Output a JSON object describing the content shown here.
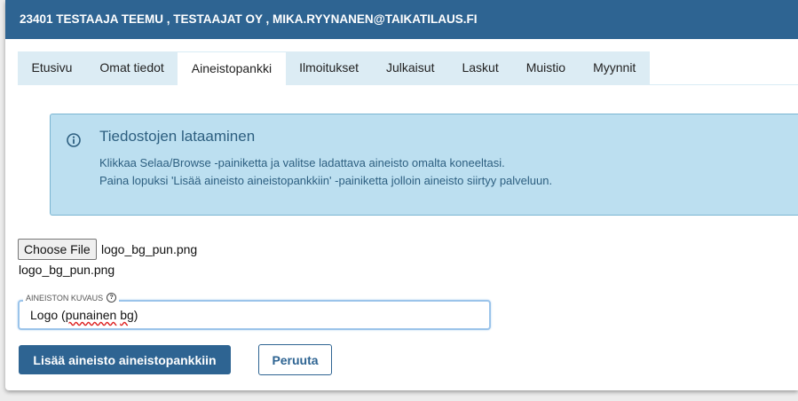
{
  "header": {
    "title": "23401 TESTAAJA TEEMU , TESTAAJAT OY , MIKA.RYYNANEN@TAIKATILAUS.FI"
  },
  "tabs": [
    {
      "label": "Etusivu",
      "active": false
    },
    {
      "label": "Omat tiedot",
      "active": false
    },
    {
      "label": "Aineistopankki",
      "active": true
    },
    {
      "label": "Ilmoitukset",
      "active": false
    },
    {
      "label": "Julkaisut",
      "active": false
    },
    {
      "label": "Laskut",
      "active": false
    },
    {
      "label": "Muistio",
      "active": false
    },
    {
      "label": "Myynnit",
      "active": false
    }
  ],
  "info": {
    "icon": "info-icon",
    "title": "Tiedostojen lataaminen",
    "line1": "Klikkaa Selaa/Browse -painiketta ja valitse ladattava aineisto omalta koneeltasi.",
    "line2": "Paina lopuksi 'Lisää aineisto aineistopankkiin' -painiketta jolloin aineisto siirtyy palveluun."
  },
  "file": {
    "choose_label": "Choose File",
    "chosen_name": "logo_bg_pun.png",
    "name_below": "logo_bg_pun.png"
  },
  "description": {
    "label": "AINEISTON KUVAUS",
    "help_icon": "help-icon",
    "value_before": "Logo (",
    "value_mid": "punainen",
    "value_space": " ",
    "value_bg": "bg",
    "value_after": ")"
  },
  "actions": {
    "submit_label": "Lisää aineisto aineistopankkiin",
    "cancel_label": "Peruuta"
  },
  "colors": {
    "header_bg": "#2e6492",
    "tab_bg": "#dcecf4",
    "alert_bg": "#bcdff0",
    "primary": "#2e6492"
  }
}
